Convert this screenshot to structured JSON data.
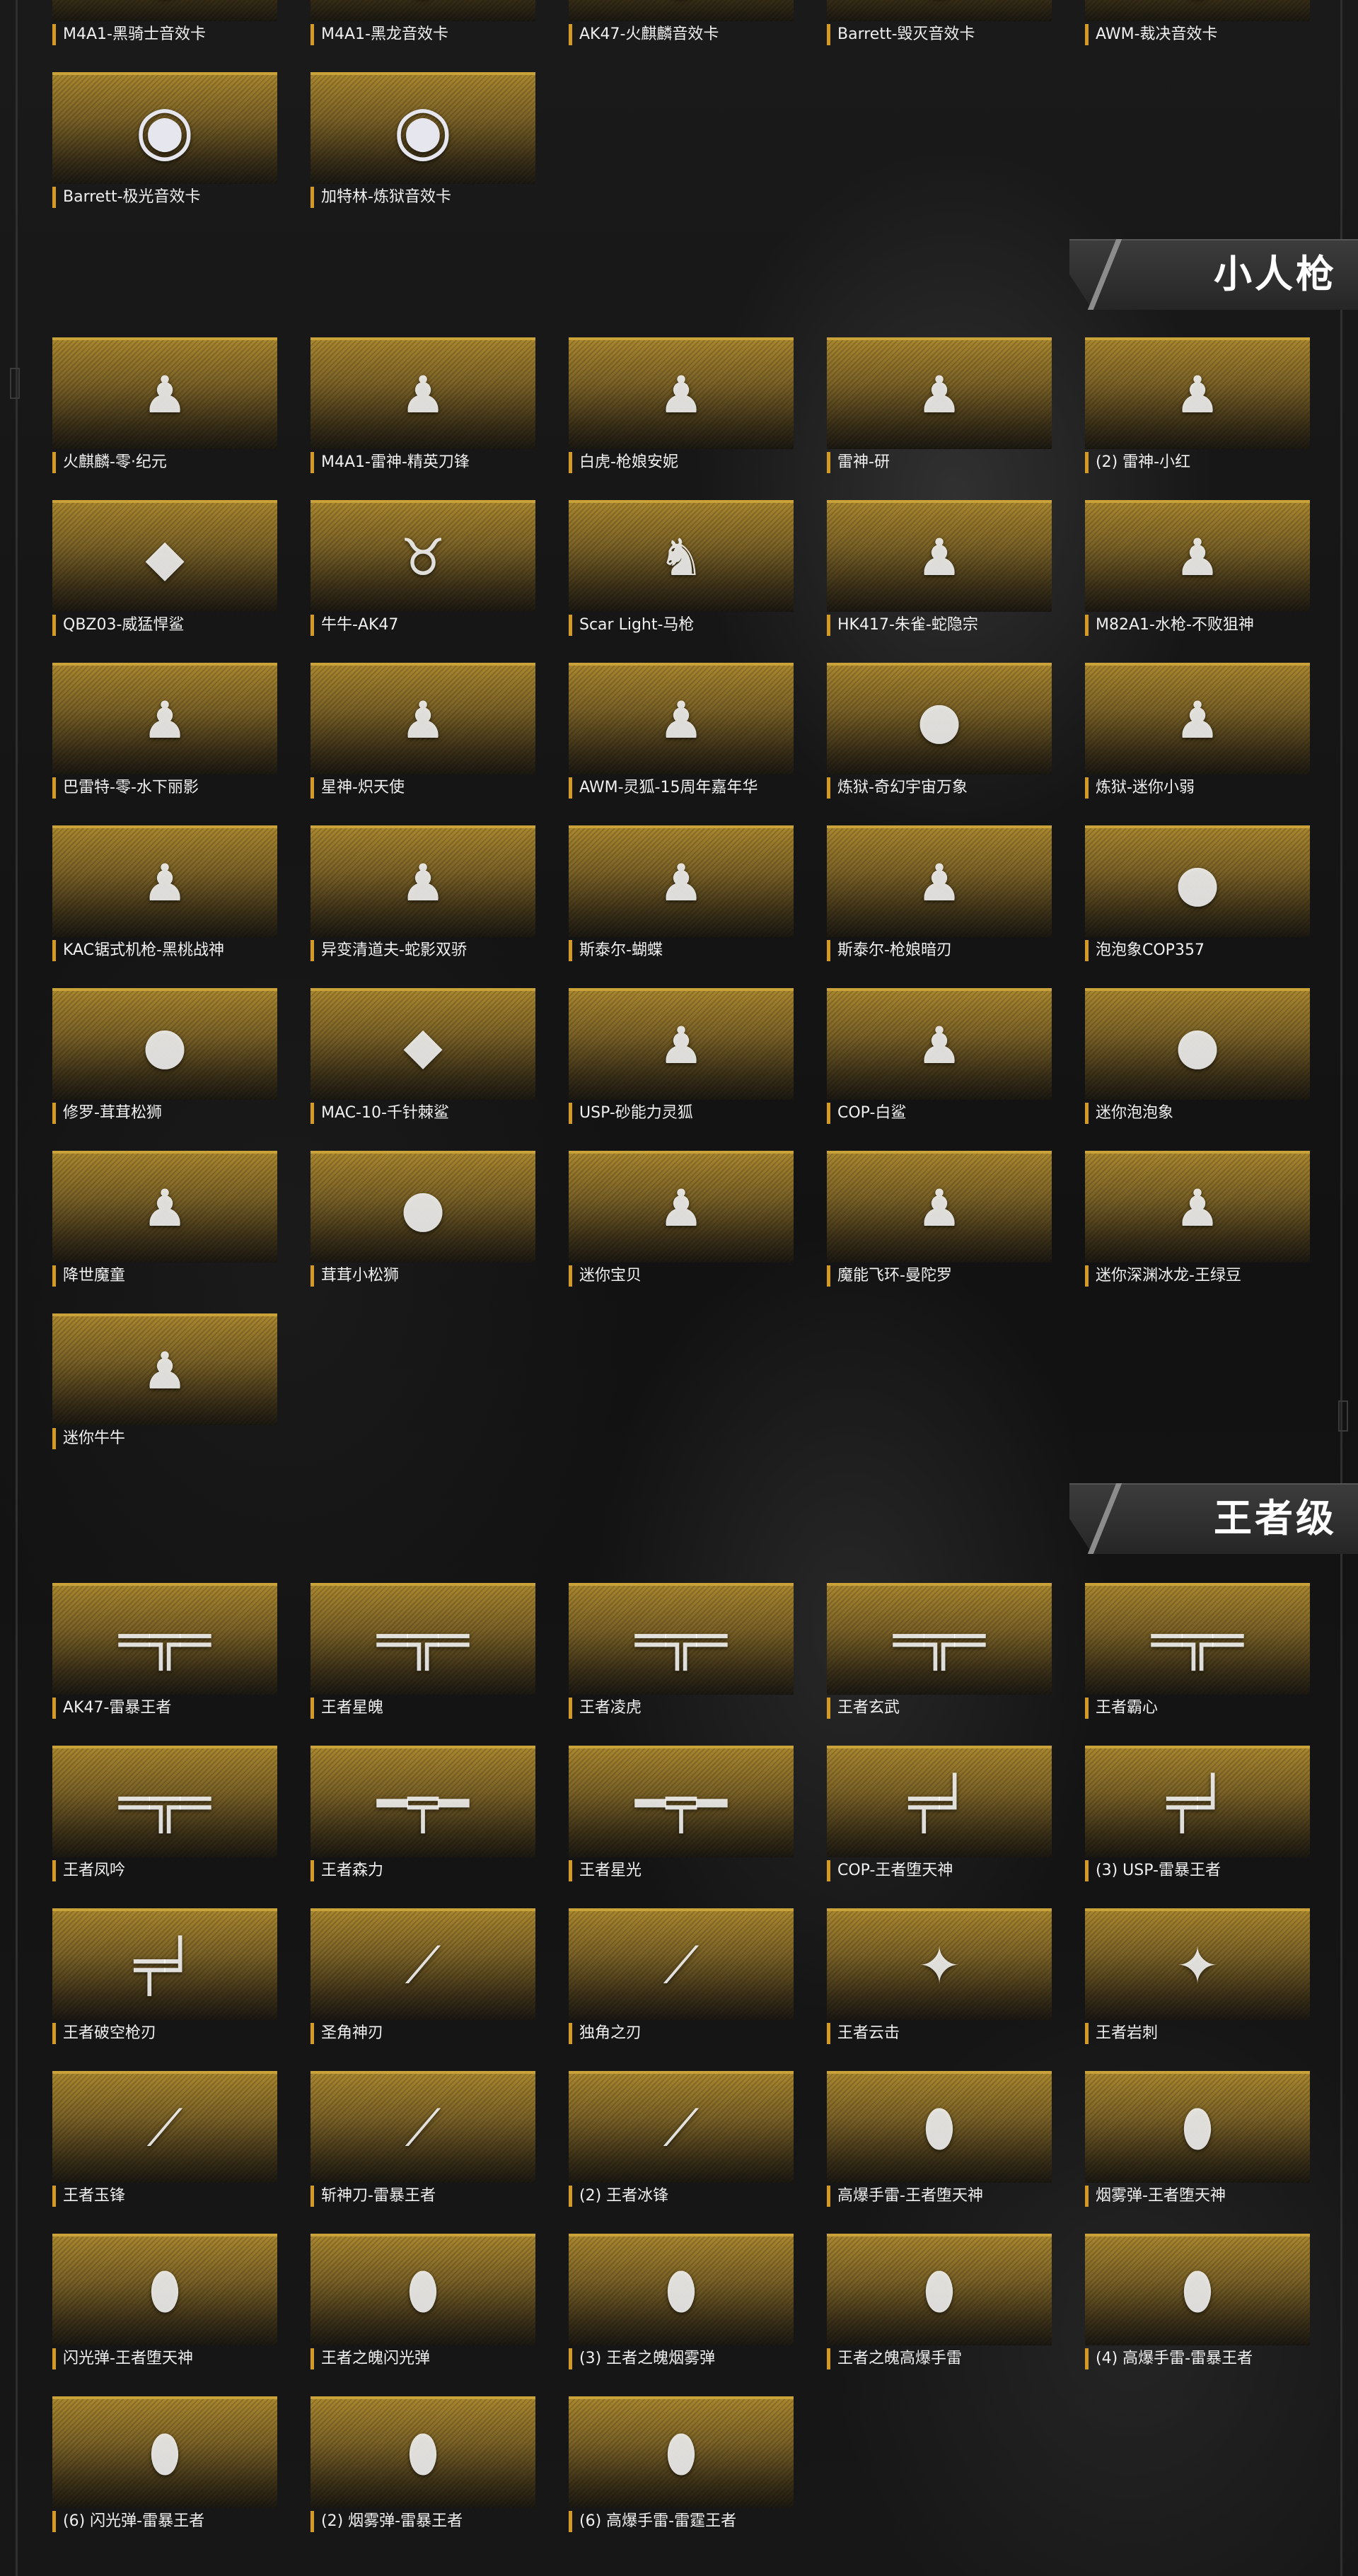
{
  "sections": [
    {
      "title": "",
      "items": [
        {
          "label": "M4A1-黑骑士音效卡",
          "icon": "disc-icon"
        },
        {
          "label": "M4A1-黑龙音效卡",
          "icon": "disc-icon"
        },
        {
          "label": "AK47-火麒麟音效卡",
          "icon": "disc-icon"
        },
        {
          "label": "Barrett-毁灭音效卡",
          "icon": "disc-icon"
        },
        {
          "label": "AWM-裁决音效卡",
          "icon": "disc-icon"
        },
        {
          "label": "Barrett-极光音效卡",
          "icon": "disc-icon"
        },
        {
          "label": "加特林-炼狱音效卡",
          "icon": "disc-icon"
        }
      ]
    },
    {
      "title": "小人枪",
      "items": [
        {
          "label": "火麒麟-零·纪元",
          "icon": "figure-icon"
        },
        {
          "label": "M4A1-雷神-精英刀锋",
          "icon": "figure-icon"
        },
        {
          "label": "白虎-枪娘安妮",
          "icon": "figure-icon"
        },
        {
          "label": "雷神-研",
          "icon": "figure-icon"
        },
        {
          "label": "(2) 雷神-小红",
          "icon": "figure-icon"
        },
        {
          "label": "QBZ03-威猛悍鲨",
          "icon": "shark-icon"
        },
        {
          "label": "牛牛-AK47",
          "icon": "ox-icon"
        },
        {
          "label": "Scar Light-马枪",
          "icon": "horse-icon"
        },
        {
          "label": "HK417-朱雀-蛇隐宗",
          "icon": "figure-icon"
        },
        {
          "label": "M82A1-水枪-不败狙神",
          "icon": "figure-icon"
        },
        {
          "label": "巴雷特-零-水下丽影",
          "icon": "figure-icon"
        },
        {
          "label": "星神-炽天使",
          "icon": "figure-icon"
        },
        {
          "label": "AWM-灵狐-15周年嘉年华",
          "icon": "figure-icon"
        },
        {
          "label": "炼狱-奇幻宇宙万象",
          "icon": "elephant-icon"
        },
        {
          "label": "炼狱-迷你小弱",
          "icon": "figure-icon"
        },
        {
          "label": "KAC锯式机枪-黑桃战神",
          "icon": "figure-icon"
        },
        {
          "label": "异变清道夫-蛇影双骄",
          "icon": "figure-icon"
        },
        {
          "label": "斯泰尔-蝴蝶",
          "icon": "figure-icon"
        },
        {
          "label": "斯泰尔-枪娘暗刃",
          "icon": "figure-icon"
        },
        {
          "label": "泡泡象COP357",
          "icon": "elephant-icon"
        },
        {
          "label": "修罗-茸茸松狮",
          "icon": "dog-icon"
        },
        {
          "label": "MAC-10-千针棘鲨",
          "icon": "shark-icon"
        },
        {
          "label": "USP-砂能力灵狐",
          "icon": "figure-icon"
        },
        {
          "label": "COP-白鲨",
          "icon": "figure-icon"
        },
        {
          "label": "迷你泡泡象",
          "icon": "elephant-icon"
        },
        {
          "label": "降世魔童",
          "icon": "figure-icon"
        },
        {
          "label": "茸茸小松狮",
          "icon": "dog-icon"
        },
        {
          "label": "迷你宝贝",
          "icon": "figure-icon"
        },
        {
          "label": "魔能飞环-曼陀罗",
          "icon": "figure-icon"
        },
        {
          "label": "迷你深渊冰龙-王绿豆",
          "icon": "figure-icon"
        },
        {
          "label": "迷你牛牛",
          "icon": "figure-icon"
        }
      ]
    },
    {
      "title": "王者级",
      "items": [
        {
          "label": "AK47-雷暴王者",
          "icon": "rifle-icon"
        },
        {
          "label": "王者星魄",
          "icon": "rifle-icon"
        },
        {
          "label": "王者凌虎",
          "icon": "rifle-icon"
        },
        {
          "label": "王者玄武",
          "icon": "rifle-icon"
        },
        {
          "label": "王者霸心",
          "icon": "rifle-icon"
        },
        {
          "label": "王者凤吟",
          "icon": "rifle-icon"
        },
        {
          "label": "王者森力",
          "icon": "sniper-icon"
        },
        {
          "label": "王者星光",
          "icon": "sniper-icon"
        },
        {
          "label": "COP-王者堕天神",
          "icon": "pistol-icon"
        },
        {
          "label": "(3) USP-雷暴王者",
          "icon": "pistol-icon"
        },
        {
          "label": "王者破空枪刃",
          "icon": "pistol-icon"
        },
        {
          "label": "圣角神刃",
          "icon": "blade-icon"
        },
        {
          "label": "独角之刃",
          "icon": "blade-icon"
        },
        {
          "label": "王者云击",
          "icon": "axe-icon"
        },
        {
          "label": "王者岩刺",
          "icon": "axe-icon"
        },
        {
          "label": "王者玉锋",
          "icon": "blade-icon"
        },
        {
          "label": "斩神刀-雷暴王者",
          "icon": "blade-icon"
        },
        {
          "label": "(2) 王者冰锋",
          "icon": "blade-icon"
        },
        {
          "label": "高爆手雷-王者堕天神",
          "icon": "grenade-icon"
        },
        {
          "label": "烟雾弹-王者堕天神",
          "icon": "grenade-icon"
        },
        {
          "label": "闪光弹-王者堕天神",
          "icon": "grenade-icon"
        },
        {
          "label": "王者之魄闪光弹",
          "icon": "grenade-icon"
        },
        {
          "label": "(3) 王者之魄烟雾弹",
          "icon": "grenade-icon"
        },
        {
          "label": "王者之魄高爆手雷",
          "icon": "grenade-icon"
        },
        {
          "label": "(4) 高爆手雷-雷暴王者",
          "icon": "grenade-icon"
        },
        {
          "label": "(6) 闪光弹-雷暴王者",
          "icon": "grenade-icon"
        },
        {
          "label": "(2) 烟雾弹-雷暴王者",
          "icon": "grenade-icon"
        },
        {
          "label": "(6) 高爆手雷-雷霆王者",
          "icon": "grenade-icon"
        }
      ]
    }
  ],
  "colors": {
    "accent": "#d59a22",
    "card_gold": "#a8862f",
    "background": "#151515",
    "banner": "#333333"
  }
}
